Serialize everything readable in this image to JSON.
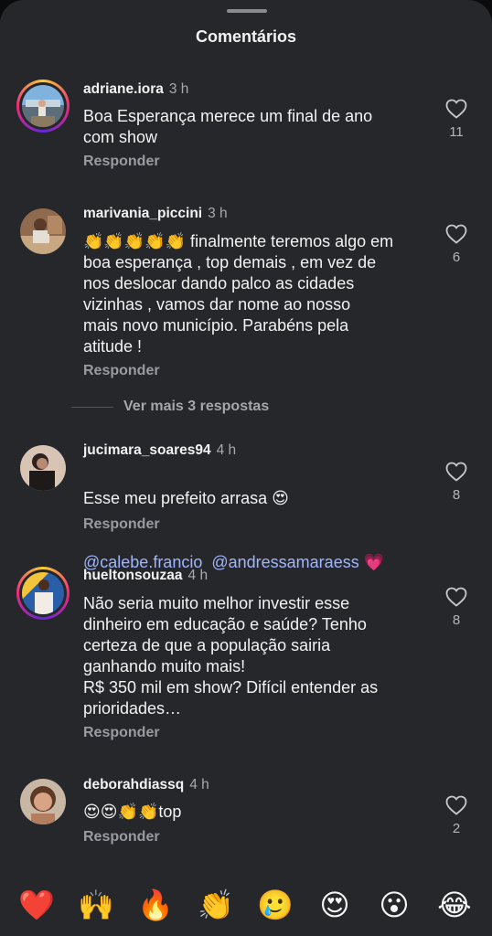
{
  "header": {
    "title": "Comentários"
  },
  "comments": [
    {
      "username": "adriane.iora",
      "time": "3 h",
      "text": "Boa Esperança merece um final de ano\ncom show",
      "reply": "Responder",
      "likes": "11"
    },
    {
      "username": "marivania_piccini",
      "time": "3 h",
      "text": "👏👏👏👏👏 finalmente teremos algo em\nboa esperança , top demais , em vez de\nnos deslocar dando palco as cidades\nvizinhas , vamos dar nome ao nosso\nmais novo município. Parabéns pela\natitude !",
      "reply": "Responder",
      "likes": "6"
    },
    {
      "username": "jucimara_soares94",
      "time": "4 h",
      "text_line1": "Esse meu prefeito arrasa 😍",
      "mention1": "@calebe.francio",
      "mention2": "@andressamaraess",
      "heart": "💗",
      "reply": "Responder",
      "likes": "8"
    },
    {
      "username": "hueltonsouzaa",
      "time": "4 h",
      "text": "Não seria muito melhor investir esse\ndinheiro em educação e saúde? Tenho\ncerteza de que a população sairia\nganhando muito mais!\nR$ 350 mil em show? Difícil entender as\nprioridades…",
      "reply": "Responder",
      "likes": "8"
    },
    {
      "username": "deborahdiassq",
      "time": "4 h",
      "text": "😍😍👏👏top",
      "reply": "Responder",
      "likes": "2"
    }
  ],
  "view_more": "Ver mais 3 respostas",
  "emoji_bar": [
    "❤️",
    "🙌",
    "🔥",
    "👏",
    "🥲",
    "😍",
    "😮",
    "😂"
  ],
  "colors": {
    "sheet": "#25272b",
    "mention": "#9fb6ff",
    "secondary": "#9a9aa0"
  }
}
